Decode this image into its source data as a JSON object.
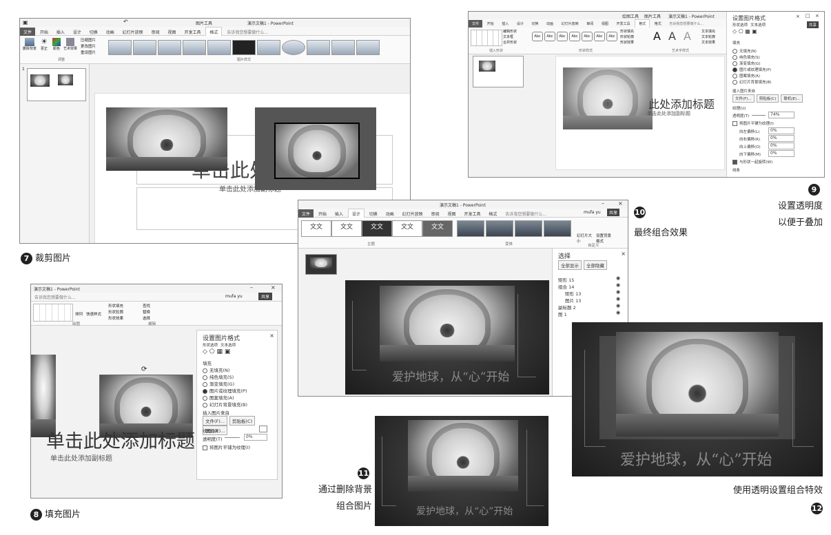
{
  "s7": {
    "tool_tab": "图片工具",
    "title": "演示文稿1 - PowerPoint",
    "tabs": [
      "文件",
      "开始",
      "插入",
      "设计",
      "切换",
      "动画",
      "幻灯片放映",
      "审阅",
      "视图",
      "开发工具",
      "格式"
    ],
    "tell_me": "告诉我您想要做什么...",
    "ribbon_items": [
      "删除背景",
      "更正",
      "颜色",
      "艺术效果",
      "压缩图片",
      "更改图片",
      "重设图片"
    ],
    "group_adjust": "调整",
    "group_styles": "图片样式",
    "slide_title": "单击此处添加标题",
    "slide_subtitle": "单击此处添加副标题",
    "slide_no": "1"
  },
  "s8": {
    "title": "演示文稿1 - PowerPoint",
    "tell_me": "告诉我您想要做什么...",
    "user": "mufa yu",
    "share": "共享",
    "ribbon": [
      "排列",
      "快速样式",
      "形状填充",
      "形状轮廓",
      "形状效果",
      "查找",
      "替换",
      "选择"
    ],
    "group_draw": "绘图",
    "group_edit": "编辑",
    "pane_title": "设置图片格式",
    "pane_tabs": [
      "形状选项",
      "文本选项"
    ],
    "section_fill": "填充",
    "fill_options": [
      "无填充(N)",
      "纯色填充(S)",
      "渐变填充(G)",
      "图片或纹理填充(P)",
      "图案填充(A)",
      "幻灯片背景填充(B)"
    ],
    "insert_from": "插入图片来自",
    "btn_file": "文件(F)...",
    "btn_clipboard": "剪贴板(C)",
    "btn_online": "联机(E)...",
    "texture": "纹理(U)",
    "transparency": "透明度(T)",
    "transparency_value": "0%",
    "tile": "将图片平铺为纹理(I)",
    "slide_title": "单击此处添加标题",
    "slide_subtitle": "单击此处添加副标题"
  },
  "s9": {
    "title": "演示文稿1 - PowerPoint",
    "tool_tabs": [
      "绘图工具",
      "图片工具"
    ],
    "tell_me": "告诉我您想要做什么...",
    "tabs": [
      "文件",
      "开始",
      "插入",
      "设计",
      "切换",
      "动画",
      "幻灯片放映",
      "审阅",
      "视图",
      "开发工具",
      "格式",
      "格式"
    ],
    "ribbon_labels": [
      "编辑形状",
      "文本框",
      "合并形状",
      "形状样式",
      "形状填充",
      "形状轮廓",
      "形状效果",
      "艺术字样式",
      "文本填充",
      "文本轮廓",
      "文本效果"
    ],
    "group_insert_shape": "插入形状",
    "group_shape_style": "形状样式",
    "group_wordart": "艺术字样式",
    "style_sample": "Abc",
    "wordart_sample": "A",
    "share": "共享",
    "pane_title": "设置图片格式",
    "pane_tabs": [
      "形状选项",
      "文本选项"
    ],
    "section_fill": "填充",
    "fill_options": [
      "无填充(N)",
      "纯色填充(S)",
      "渐变填充(G)",
      "图片或纹理填充(P)",
      "图案填充(A)",
      "幻灯片背景填充(B)"
    ],
    "insert_from": "插入图片来自",
    "btn_file": "文件(F)...",
    "btn_clipboard": "剪贴板(C)",
    "btn_online": "联机(E)...",
    "texture": "纹理(U)",
    "transparency": "透明度(T)",
    "transparency_value": "74%",
    "tile": "将图片平铺为纹理(I)",
    "offset_left": "向左偏移(L)",
    "offset_right": "向右偏移(R)",
    "offset_top": "向上偏移(O)",
    "offset_bottom": "向下偏移(M)",
    "offset_value": "0%",
    "rotate_with": "与形状一起旋转(W)",
    "section_line": "线条",
    "slide_title": "此处添加标题",
    "slide_subtitle": "单击此处添加副标题"
  },
  "s10": {
    "title": "演示文稿1 - PowerPoint",
    "tabs": [
      "文件",
      "开始",
      "插入",
      "设计",
      "切换",
      "动画",
      "幻灯片放映",
      "审阅",
      "视图",
      "开发工具",
      "格式"
    ],
    "tell_me": "告诉我您想要做什么...",
    "user": "mufa yu",
    "share": "共享",
    "theme_label": "文文",
    "group_theme": "主题",
    "group_variant": "变体",
    "group_custom": "自定义",
    "btn_slide_size": "幻灯片大小",
    "btn_bg_format": "设置背景格式",
    "pane_title": "选择",
    "btn_show_all": "全部显示",
    "btn_hide_all": "全部隐藏",
    "layers": [
      "矩形 15",
      "组合 14",
      "矩形 13",
      "图片 13",
      "副标题 2",
      "图 1"
    ],
    "slide_caption": "爱护地球，从“心”开始"
  },
  "captions": {
    "c7": "裁剪图片",
    "c8": "填充图片",
    "c9_line1": "设置透明度",
    "c9_line2": "以便于叠加",
    "c10": "最终组合效果",
    "c11_line1": "通过删除背景",
    "c11_line2": "组合图片",
    "c12": "使用透明设置组合特效"
  },
  "badges": {
    "n7": "7",
    "n8": "8",
    "n9": "9",
    "n10": "10",
    "n11": "11",
    "n12": "12"
  },
  "slide11": {
    "caption": "爱护地球，从“心”开始"
  },
  "slide12": {
    "caption": "爱护地球，从“心”开始"
  }
}
